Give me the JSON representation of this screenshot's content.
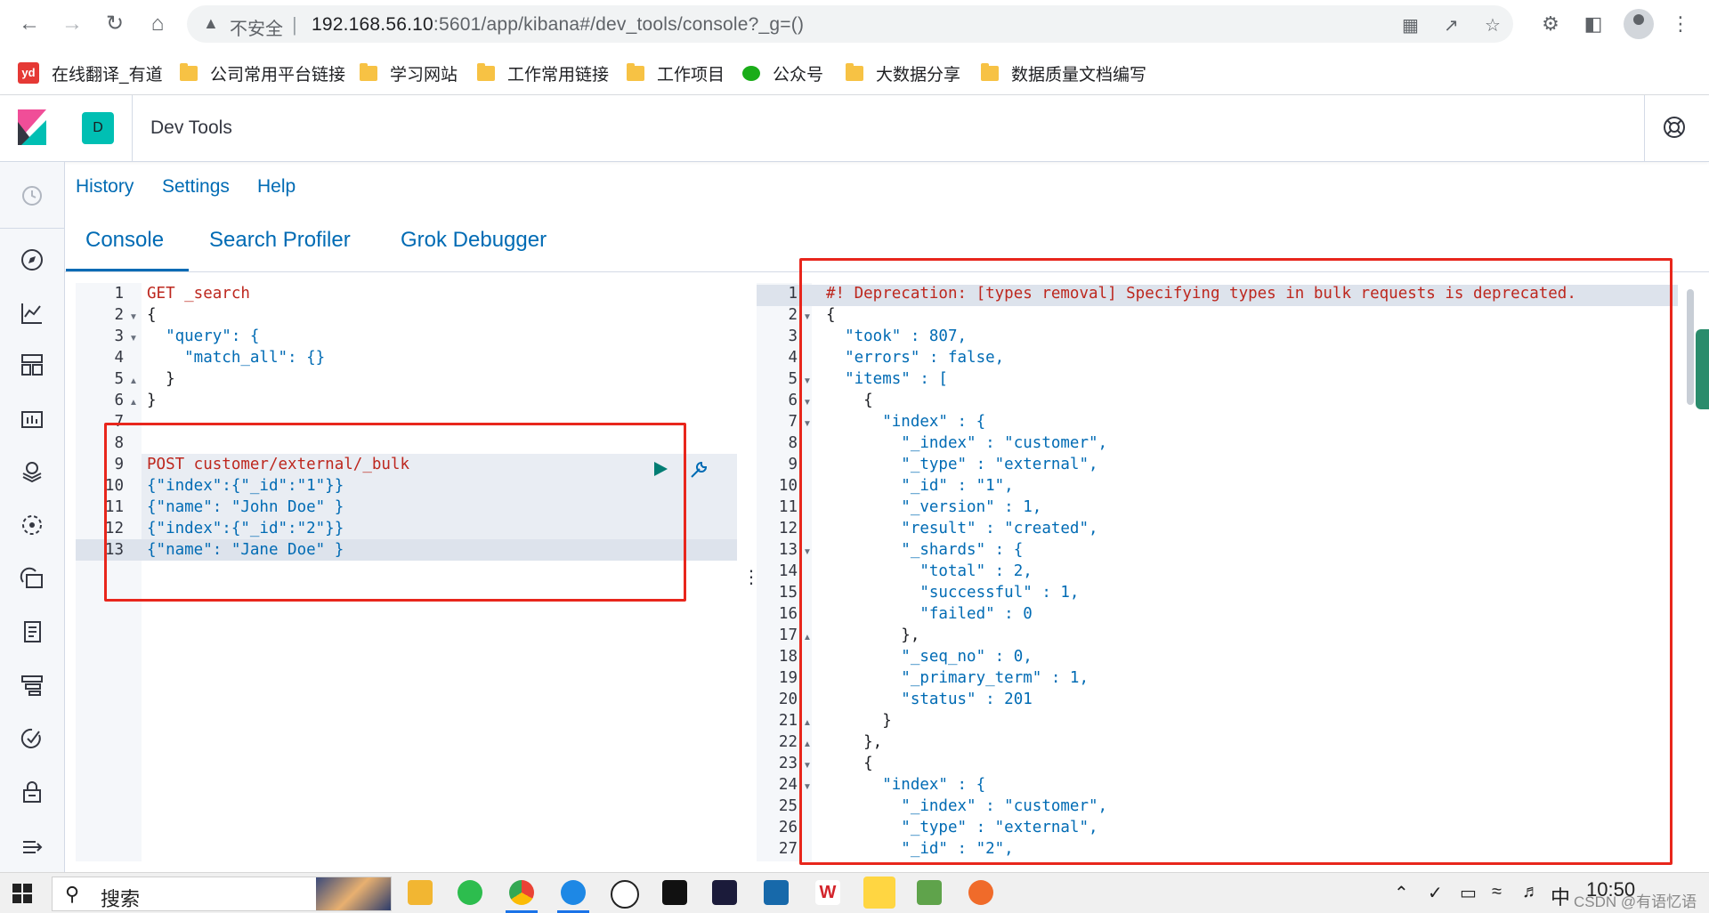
{
  "browser": {
    "security_label": "不安全",
    "url_host": "192.168.56.10",
    "url_rest": ":5601/app/kibana#/dev_tools/console?_g=()",
    "bookmarks": [
      {
        "label": "在线翻译_有道",
        "icon": "youdao-icon"
      },
      {
        "label": "公司常用平台链接",
        "icon": "folder-icon"
      },
      {
        "label": "学习网站",
        "icon": "folder-icon"
      },
      {
        "label": "工作常用链接",
        "icon": "folder-icon"
      },
      {
        "label": "工作项目",
        "icon": "folder-icon"
      },
      {
        "label": "公众号",
        "icon": "wechat-icon"
      },
      {
        "label": "大数据分享",
        "icon": "folder-icon"
      },
      {
        "label": "数据质量文档编写",
        "icon": "folder-icon"
      }
    ]
  },
  "kibana": {
    "space_initial": "D",
    "app_title": "Dev Tools",
    "top_links": [
      "History",
      "Settings",
      "Help"
    ],
    "tabs": [
      "Console",
      "Search Profiler",
      "Grok Debugger"
    ],
    "active_tab": "Console"
  },
  "editor": {
    "line_numbers": [
      "1",
      "2",
      "3",
      "4",
      "5",
      "6",
      "7",
      "8",
      "9",
      "10",
      "11",
      "12",
      "13"
    ],
    "lines": [
      "GET _search",
      "{",
      "  \"query\": {",
      "    \"match_all\": {}",
      "  }",
      "}",
      "",
      "",
      "POST customer/external/_bulk",
      "{\"index\":{\"_id\":\"1\"}}",
      "{\"name\": \"John Doe\" }",
      "{\"index\":{\"_id\":\"2\"}}",
      "{\"name\": \"Jane Doe\" }"
    ]
  },
  "output": {
    "line_numbers": [
      "1",
      "2",
      "3",
      "4",
      "5",
      "6",
      "7",
      "8",
      "9",
      "10",
      "11",
      "12",
      "13",
      "14",
      "15",
      "16",
      "17",
      "18",
      "19",
      "20",
      "21",
      "22",
      "23",
      "24",
      "25",
      "26",
      "27"
    ],
    "lines": [
      "#! Deprecation: [types removal] Specifying types in bulk requests is deprecated.",
      "{",
      "  \"took\" : 807,",
      "  \"errors\" : false,",
      "  \"items\" : [",
      "    {",
      "      \"index\" : {",
      "        \"_index\" : \"customer\",",
      "        \"_type\" : \"external\",",
      "        \"_id\" : \"1\",",
      "        \"_version\" : 1,",
      "        \"result\" : \"created\",",
      "        \"_shards\" : {",
      "          \"total\" : 2,",
      "          \"successful\" : 1,",
      "          \"failed\" : 0",
      "        },",
      "        \"_seq_no\" : 0,",
      "        \"_primary_term\" : 1,",
      "        \"status\" : 201",
      "      }",
      "    },",
      "    {",
      "      \"index\" : {",
      "        \"_index\" : \"customer\",",
      "        \"_type\" : \"external\",",
      "        \"_id\" : \"2\","
    ]
  },
  "taskbar": {
    "search_placeholder": "搜索",
    "ime": "中",
    "time": "10:50",
    "watermark": "CSDN @有语忆语"
  }
}
